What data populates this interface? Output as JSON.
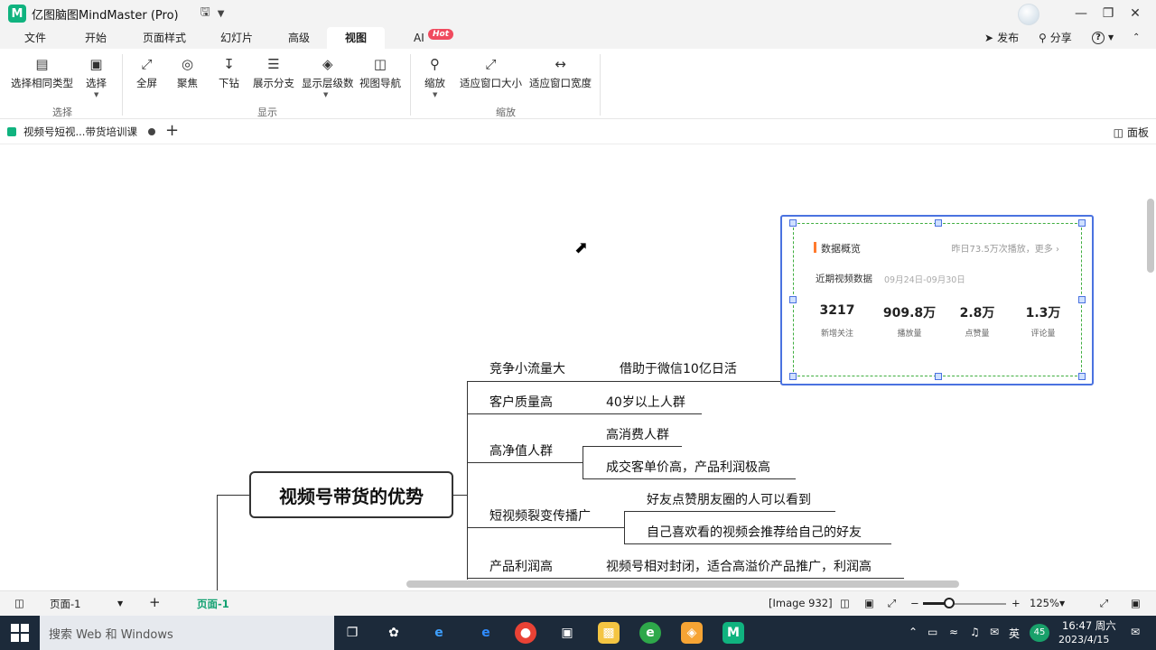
{
  "app": {
    "title": "亿图脑图MindMaster (Pro)",
    "logo_glyph": "M",
    "logo_color": "#10b37f"
  },
  "menu": {
    "tabs": [
      "文件",
      "开始",
      "页面样式",
      "幻灯片",
      "高级",
      "视图",
      "AI"
    ],
    "active_tab": "视图",
    "ai_badge": "Hot",
    "publish": "发布",
    "share": "分享",
    "help_icon": "?"
  },
  "ribbon": {
    "groups": {
      "select": "选择",
      "display": "显示",
      "zoom": "缩放"
    },
    "buttons": {
      "select_same_type": "选择相同类型",
      "select": "选择",
      "fullscreen": "全屏",
      "focus": "聚焦",
      "drill_down": "下钻",
      "show_branch": "展示分支",
      "show_level": "显示层级数",
      "view_nav": "视图导航",
      "zoom": "缩放",
      "fit_window_size": "适应窗口大小",
      "fit_window_width": "适应窗口宽度"
    }
  },
  "doc": {
    "tab_title": "视频号短视...带货培训课",
    "panel_label": "面板"
  },
  "mindmap": {
    "central": "视频号带货的优势",
    "branches": [
      {
        "label": "竞争小流量大",
        "children": [
          "借助于微信10亿日活"
        ]
      },
      {
        "label": "客户质量高",
        "children": [
          "40岁以上人群"
        ]
      },
      {
        "label": "高净值人群",
        "children": [
          "高消费人群",
          "成交客单价高，产品利润极高"
        ]
      },
      {
        "label": "短视频裂变传播广",
        "children": [
          "好友点赞朋友圈的人可以看到",
          "自己喜欢看的视频会推荐给自己的好友"
        ]
      },
      {
        "label": "产品利润高",
        "children": [
          "视频号相对封闭，适合高溢价产品推广，利润高"
        ]
      }
    ]
  },
  "image": {
    "title": "数据概览",
    "yesterday": "昨日73.5万次播放，更多 ›",
    "recent_label": "近期视频数据",
    "date_range": "09月24日-09月30日",
    "stats": [
      {
        "value": "3217",
        "label": "新增关注"
      },
      {
        "value": "909.8万",
        "label": "播放量"
      },
      {
        "value": "2.8万",
        "label": "点赞量"
      },
      {
        "value": "1.3万",
        "label": "评论量"
      }
    ]
  },
  "status": {
    "page_select": "页面-1",
    "page_tab": "页面-1",
    "image_info": "[Image 932]",
    "zoom_level": "125%",
    "zoom_minus": "−",
    "zoom_plus": "+"
  },
  "taskbar": {
    "search_placeholder": "搜索 Web 和 Windows",
    "ime": "英",
    "battery_badge": "45",
    "time": "16:47 周六",
    "date": "2023/4/15"
  }
}
